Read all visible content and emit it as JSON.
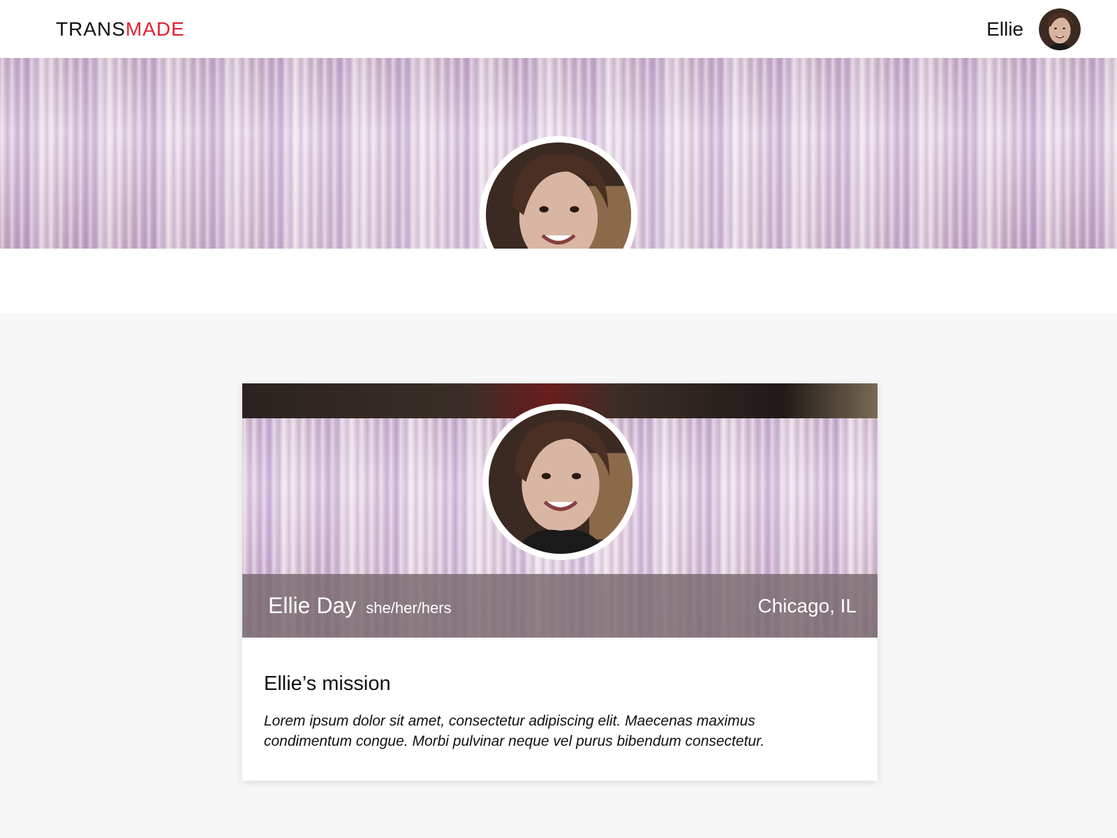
{
  "header": {
    "logo_part1": "TRANS",
    "logo_part2": "MADE",
    "user_name": "Ellie",
    "avatar_icon": "user-avatar-photo"
  },
  "hero": {
    "photo_icon": "profile-photo"
  },
  "profile_card": {
    "name": "Ellie Day",
    "pronouns": "she/her/hers",
    "location": "Chicago, IL",
    "mission_title": "Ellie’s mission",
    "mission_text": "Lorem ipsum dolor sit amet, consectetur adipiscing elit. Maecenas maximus condimentum congue. Morbi pulvinar neque vel purus bibendum consectetur."
  },
  "colors": {
    "brand_red": "#e02030",
    "text": "#111111",
    "page_bg": "#f7f7f7",
    "name_band": "#786970"
  }
}
